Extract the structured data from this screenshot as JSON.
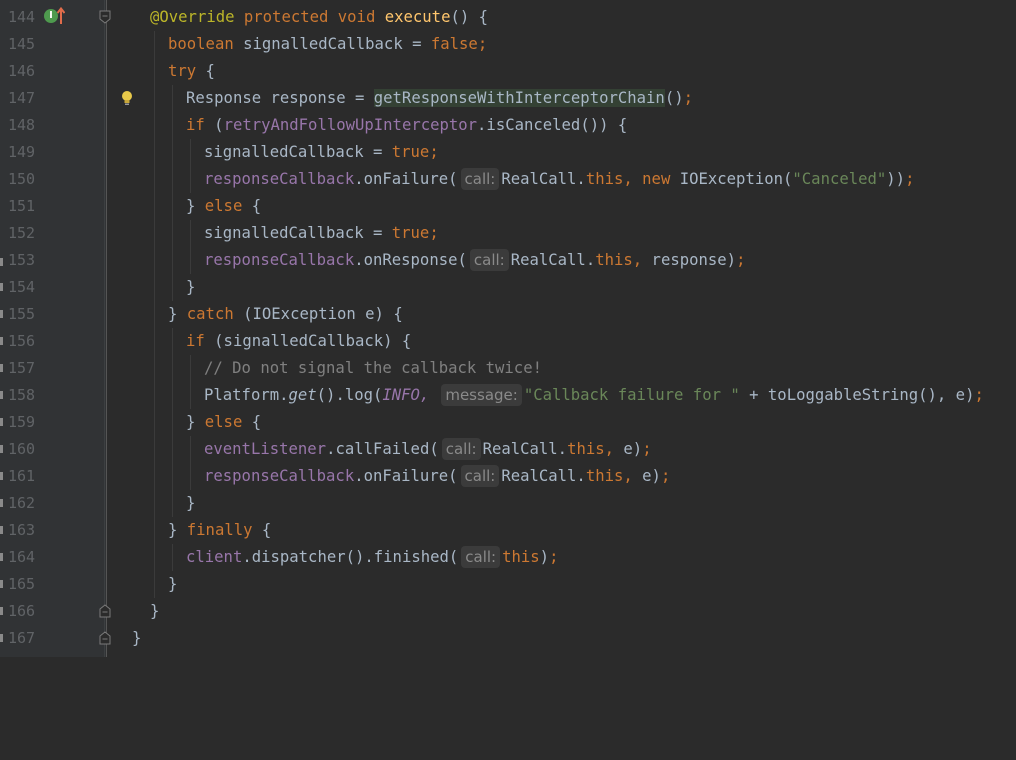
{
  "gutter": {
    "line_numbers": [
      "144",
      "145",
      "146",
      "147",
      "148",
      "149",
      "150",
      "151",
      "152",
      "153",
      "154",
      "155",
      "156",
      "157",
      "158",
      "159",
      "160",
      "161",
      "162",
      "163",
      "164",
      "165",
      "166",
      "167"
    ]
  },
  "code": {
    "l144": {
      "a1": "@Override",
      "a2": "protected",
      "a3": "void",
      "a4": "execute",
      "a5": "() {"
    },
    "l145": {
      "a1": "boolean",
      "a2": " signalledCallback = ",
      "a3": "false",
      "a4": ";"
    },
    "l146": {
      "a1": "try",
      "a2": " {"
    },
    "l147": {
      "a1": "Response response = ",
      "a2": "getResponseWithInterceptorChain",
      "a3": "()",
      "a4": ";"
    },
    "l148": {
      "a1": "if",
      "a2": " (",
      "a3": "retryAndFollowUpInterceptor",
      "a4": ".isCanceled()) {"
    },
    "l149": {
      "a1": "signalledCallback = ",
      "a2": "true",
      "a3": ";"
    },
    "l150": {
      "a1": "responseCallback",
      "a2": ".onFailure(",
      "hint": "call:",
      "a3": "RealCall.",
      "a4": "this,",
      "a5": " new",
      "a6": " IOException(",
      "a7": "\"Canceled\"",
      "a8": "))",
      "a9": ";"
    },
    "l151": {
      "a1": "} ",
      "a2": "else",
      "a3": " {"
    },
    "l152": {
      "a1": "signalledCallback = ",
      "a2": "true",
      "a3": ";"
    },
    "l153": {
      "a1": "responseCallback",
      "a2": ".onResponse(",
      "hint": "call:",
      "a3": "RealCall.",
      "a4": "this,",
      "a5": " response)",
      "a6": ";"
    },
    "l154": {
      "a1": "}"
    },
    "l155": {
      "a1": "} ",
      "a2": "catch",
      "a3": " (IOException e) {"
    },
    "l156": {
      "a1": "if",
      "a2": " (signalledCallback) {"
    },
    "l157": {
      "a1": "// Do not signal the callback twice!"
    },
    "l158": {
      "a1": "Platform.",
      "a2": "get",
      "a3": "().log(",
      "a4": "INFO,",
      "hint": "message:",
      "a5": "\"Callback failure for \"",
      "a6": " + toLoggableString(), e)",
      "a7": ";"
    },
    "l159": {
      "a1": "} ",
      "a2": "else",
      "a3": " {"
    },
    "l160": {
      "a1": "eventListener",
      "a2": ".callFailed(",
      "hint": "call:",
      "a3": "RealCall.",
      "a4": "this,",
      "a5": " e)",
      "a6": ";"
    },
    "l161": {
      "a1": "responseCallback",
      "a2": ".onFailure(",
      "hint": "call:",
      "a3": "RealCall.",
      "a4": "this,",
      "a5": " e)",
      "a6": ";"
    },
    "l162": {
      "a1": "}"
    },
    "l163": {
      "a1": "} ",
      "a2": "finally",
      "a3": " {"
    },
    "l164": {
      "a1": "client",
      "a2": ".dispatcher().finished(",
      "hint": "call:",
      "a3": "this",
      "a4": ")",
      "a5": ";"
    },
    "l165": {
      "a1": "}"
    },
    "l166": {
      "a1": "}"
    },
    "l167": {
      "a1": "}"
    }
  },
  "colors": {
    "background": "#2b2b2b",
    "keyword": "#cc7832",
    "field": "#9876aa",
    "string": "#6a8759",
    "annotation": "#bbb529",
    "comment": "#808080",
    "text": "#a9b7c6",
    "line_number": "#606366"
  },
  "icons": [
    "implements-gutter-icon",
    "override-up-arrow-icon",
    "intention-bulb-icon",
    "fold-marker-icon"
  ]
}
